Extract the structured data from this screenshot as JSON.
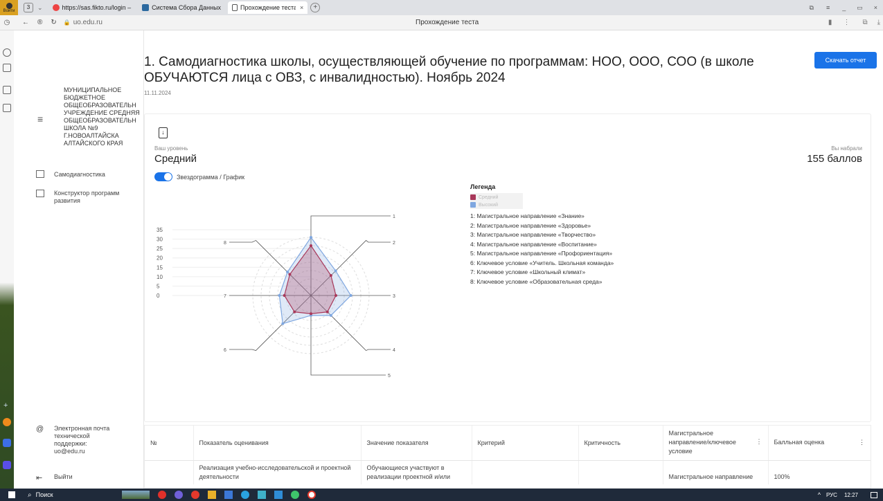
{
  "browser": {
    "profile_label": "Войти",
    "tab_count": "3",
    "tabs": [
      {
        "label": "https://sas.fikto.ru/login –"
      },
      {
        "label": "Система Сбора Данных"
      },
      {
        "label": "Прохождение теста"
      }
    ],
    "address": "uo.edu.ru",
    "page_title": "Прохождение теста"
  },
  "sidebar": {
    "org_name": "МУНИЦИПАЛЬНОЕ БЮДЖЕТНОЕ ОБЩЕОБРАЗОВАТЕЛЬН УЧРЕЖДЕНИЕ СРЕДНЯЯ ОБЩЕОБРАЗОВАТЕЛЬН ШКОЛА №9 Г.НОВОАЛТАЙСКА АЛТАЙСКОГО КРАЯ",
    "nav": [
      {
        "label": "Самодиагностика"
      },
      {
        "label": "Конструктор программ развития"
      }
    ],
    "support": "Электронная почта технической поддержки: uo@edu.ru",
    "logout": "Выйти"
  },
  "header": {
    "title": "1. Самодиагностика школы, осуществляющей обучение по программам: НОО, ООО, СОО (в школе ОБУЧАЮТСЯ лица с ОВЗ, с инвалидностью). Ноябрь 2024",
    "date": "11.11.2024",
    "download_label": "Скачать отчет"
  },
  "result": {
    "level_caption": "Ваш уровень",
    "level_value": "Средний",
    "score_caption": "Вы набрали",
    "score_value": "155 баллов",
    "toggle_label": "Звездограмма / График"
  },
  "legend": {
    "title": "Легенда",
    "series": [
      {
        "name": "Средний",
        "color": "#a8385a"
      },
      {
        "name": "Высокий",
        "color": "#7fa7e0"
      }
    ],
    "items": [
      "1: Магистральное направление «Знание»",
      "2: Магистральное направление «Здоровье»",
      "3: Магистральное направление «Творчество»",
      "4: Магистральное направление «Воспитание»",
      "5: Магистральное направление «Профориентация»",
      "6: Ключевое условие «Учитель. Школьная команда»",
      "7: Ключевое условие «Школьный климат»",
      "8: Ключевое условие «Образовательная среда»"
    ]
  },
  "chart_data": {
    "type": "radar",
    "axes": [
      "1",
      "2",
      "3",
      "4",
      "5",
      "6",
      "7",
      "8"
    ],
    "ticks": [
      "35",
      "30",
      "25",
      "20",
      "15",
      "10",
      "5",
      "0"
    ],
    "max": 40,
    "series": [
      {
        "name": "Средний",
        "values": [
          30,
          17,
          15,
          14,
          11,
          14,
          16,
          18
        ]
      },
      {
        "name": "Высокий",
        "values": [
          35,
          21,
          24,
          17,
          12,
          24,
          19,
          20
        ]
      }
    ]
  },
  "table": {
    "columns": [
      "№",
      "Показатель оценивания",
      "Значение показателя",
      "Критерий",
      "Критичность",
      "Магистральное направление/ключевое условие",
      "Балльная оценка"
    ],
    "rows": [
      [
        "",
        "Реализация учебно-исследовательской и проектной деятельности",
        "Обучающиеся участвуют в реализации проектной и/или",
        "",
        "",
        "Магистральное направление",
        "100%"
      ]
    ]
  },
  "taskbar": {
    "search_label": "Поиск",
    "lang": "РУС",
    "time": "12:27"
  }
}
